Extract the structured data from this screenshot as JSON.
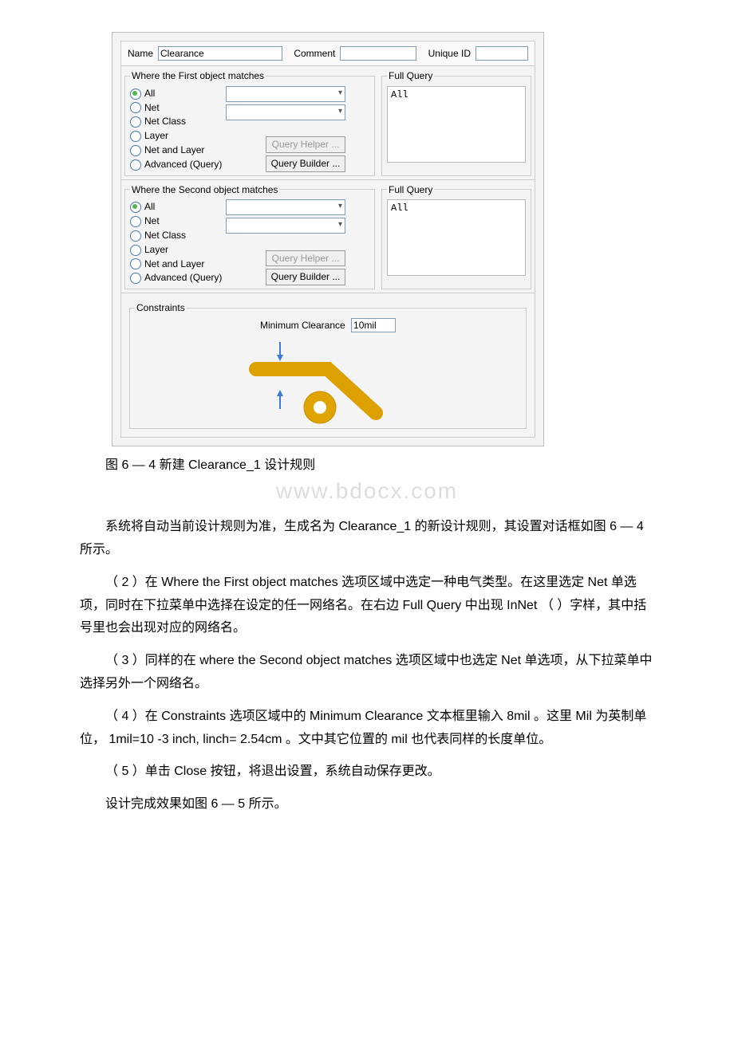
{
  "dialog": {
    "name_label": "Name",
    "name_value": "Clearance",
    "comment_label": "Comment",
    "comment_value": "",
    "uid_label": "Unique ID",
    "uid_value": "",
    "first_title": "Where the First object matches",
    "second_title": "Where the Second object matches",
    "radios": [
      "All",
      "Net",
      "Net Class",
      "Layer",
      "Net and Layer",
      "Advanced (Query)"
    ],
    "query_helper": "Query Helper ...",
    "query_builder": "Query Builder ...",
    "full_query_title": "Full Query",
    "full_query_value": "All",
    "constraints_title": "Constraints",
    "min_clearance_label": "Minimum Clearance",
    "min_clearance_value": "10mil"
  },
  "caption": "图 6 — 4 新建 Clearance_1 设计规则",
  "watermark": "www.bdocx.com",
  "para1": "系统将自动当前设计规则为准，生成名为 Clearance_1 的新设计规则，其设置对话框如图 6 — 4 所示。",
  "para2": "（ 2 ）在 Where the First object matches 选项区域中选定一种电气类型。在这里选定 Net 单选项，同时在下拉菜单中选择在设定的任一网络名。在右边 Full Query 中出现 InNet （ ）字样，其中括号里也会出现对应的网络名。",
  "para3": "（ 3 ）同样的在 where the Second object matches 选项区域中也选定 Net 单选项，从下拉菜单中选择另外一个网络名。",
  "para4": "（ 4 ）在 Constraints 选项区域中的 Minimum Clearance 文本框里输入 8mil 。这里 Mil 为英制单位， 1mil=10 -3 inch, linch= 2.54cm 。文中其它位置的 mil 也代表同样的长度单位。",
  "para5": "（ 5 ）单击 Close 按钮，将退出设置，系统自动保存更改。",
  "para6": "设计完成效果如图 6 — 5 所示。"
}
